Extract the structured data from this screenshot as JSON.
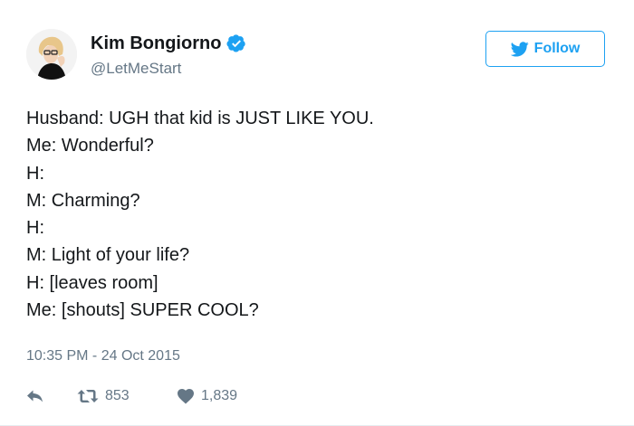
{
  "user": {
    "display_name": "Kim Bongiorno",
    "handle": "@LetMeStart",
    "verified": true,
    "avatar_icon": "avatar-photo"
  },
  "follow_button": {
    "label": "Follow",
    "icon": "twitter-bird-icon",
    "color": "#1da1f2"
  },
  "tweet": {
    "lines": [
      "Husband: UGH that kid is JUST LIKE YOU.",
      "Me: Wonderful?",
      "H:",
      "M: Charming?",
      "H:",
      "M: Light of your life?",
      "H: [leaves room]",
      "Me: [shouts] SUPER COOL?"
    ],
    "timestamp": "10:35 PM - 24 Oct 2015"
  },
  "actions": {
    "reply": {
      "icon": "reply-icon"
    },
    "retweet": {
      "icon": "retweet-icon",
      "count": "853"
    },
    "like": {
      "icon": "heart-icon",
      "count": "1,839"
    }
  },
  "colors": {
    "text": "#14171a",
    "muted": "#657786",
    "accent": "#1da1f2",
    "verified": "#1da1f2"
  }
}
